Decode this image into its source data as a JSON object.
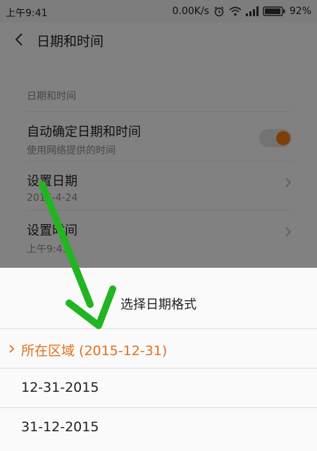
{
  "status_bar": {
    "time": "上午9:41",
    "speed": "0.00K/s",
    "battery": "92%"
  },
  "header": {
    "title": "日期和时间"
  },
  "settings": {
    "section_header": "日期和时间",
    "auto": {
      "label": "自动确定日期和时间",
      "sub": "使用网络提供的时间",
      "enabled": true
    },
    "set_date": {
      "label": "设置日期",
      "value": "2015-4-24"
    },
    "set_time": {
      "label": "设置时间",
      "value": "上午9:41"
    }
  },
  "sheet": {
    "title": "选择日期格式",
    "options": [
      {
        "label": "所在区域 (2015-12-31)",
        "selected": true
      },
      {
        "label": "12-31-2015",
        "selected": false
      },
      {
        "label": "31-12-2015",
        "selected": false
      }
    ]
  },
  "colors": {
    "accent": "#f07a18",
    "arrow": "#22b522"
  }
}
